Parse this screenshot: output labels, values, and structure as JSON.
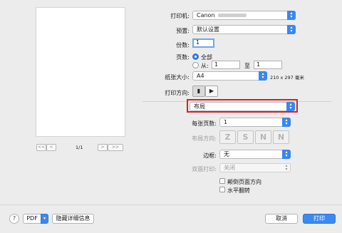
{
  "preview": {
    "page_indicator": "1/1",
    "nav_first": "<<",
    "nav_prev": "<",
    "nav_next": ">",
    "nav_last": ">>"
  },
  "printer": {
    "label": "打印机:",
    "value": "Canon"
  },
  "presets": {
    "label": "预置:",
    "value": "默认设置"
  },
  "copies": {
    "label": "份数:",
    "value": "1"
  },
  "pages": {
    "label": "页数:",
    "all_label": "全部",
    "from_label": "从:",
    "from_value": "1",
    "to_label": "至",
    "to_value": "1"
  },
  "paper_size": {
    "label": "纸张大小:",
    "value": "A4",
    "dimensions": "210 x 297 毫米"
  },
  "orientation": {
    "label": "打印方向:"
  },
  "section": {
    "value": "布局"
  },
  "layout": {
    "pages_per_sheet_label": "每张页数:",
    "pages_per_sheet_value": "1",
    "direction_label": "布局方向:",
    "direction_options": [
      "Z",
      "S",
      "N",
      "N"
    ],
    "border_label": "边框:",
    "border_value": "无",
    "two_sided_label": "双面打印:",
    "two_sided_value": "关闭",
    "reverse_label": "颠倒页面方向",
    "flip_label": "水平翻转"
  },
  "bottom": {
    "help": "?",
    "pdf": "PDF",
    "hide_details": "隐藏详细信息",
    "cancel": "取消",
    "print": "打印"
  },
  "colors": {
    "accent": "#3b8af2",
    "highlight_border": "#d7211f"
  }
}
